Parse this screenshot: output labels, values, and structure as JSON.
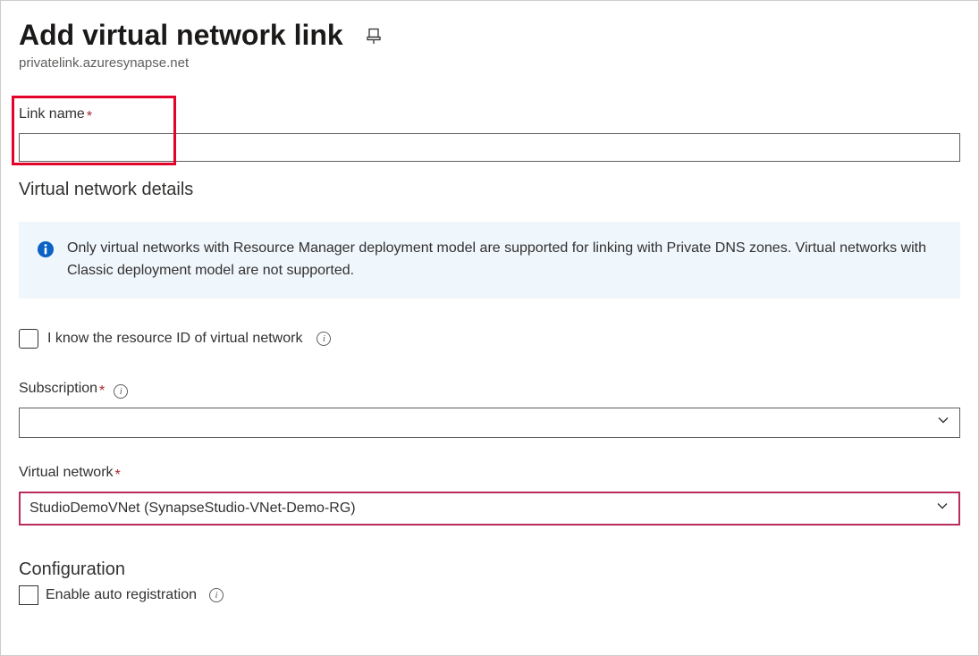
{
  "header": {
    "title": "Add virtual network link",
    "subtitle": "privatelink.azuresynapse.net"
  },
  "link_name": {
    "label": "Link name",
    "value": ""
  },
  "vnet_details": {
    "heading": "Virtual network details",
    "info_text": "Only virtual networks with Resource Manager deployment model are supported for linking with Private DNS zones. Virtual networks with Classic deployment model are not supported.",
    "know_resource_id_label": "I know the resource ID of virtual network"
  },
  "subscription": {
    "label": "Subscription",
    "value": ""
  },
  "virtual_network": {
    "label": "Virtual network",
    "value": "StudioDemoVNet (SynapseStudio-VNet-Demo-RG)"
  },
  "configuration": {
    "heading": "Configuration",
    "auto_reg_label": "Enable auto registration"
  }
}
